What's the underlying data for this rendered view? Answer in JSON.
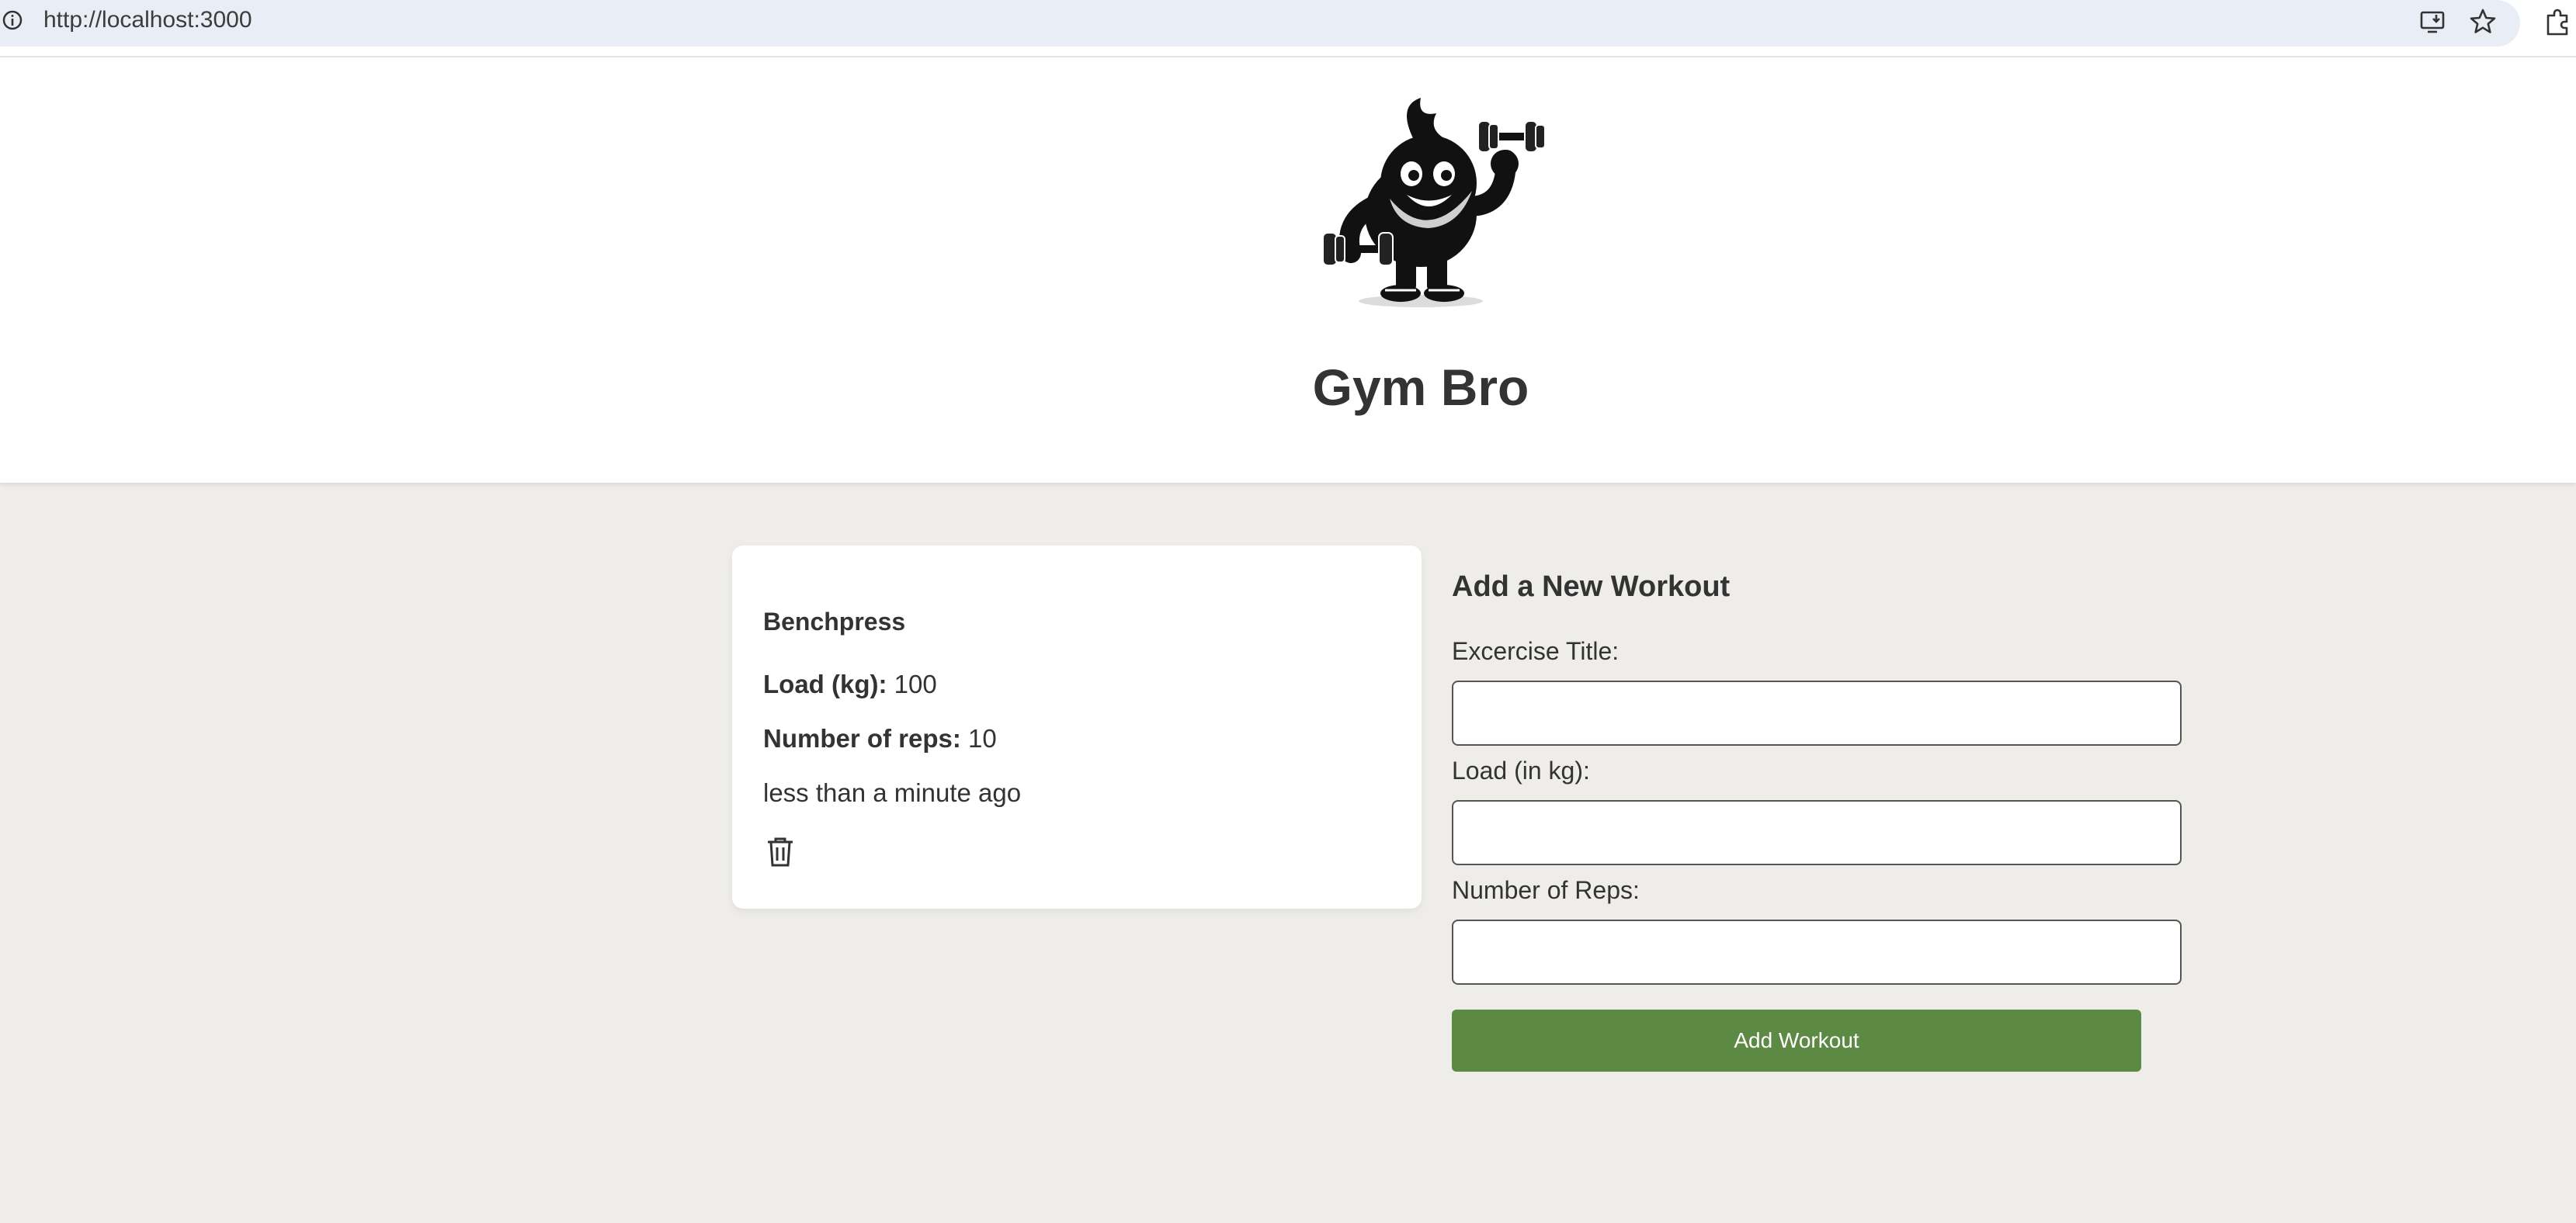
{
  "browser": {
    "url": "http://localhost:3000",
    "icons": [
      "info-icon",
      "install-app-icon",
      "bookmark-star-icon",
      "extensions-icon"
    ]
  },
  "header": {
    "logo": "gym-mascot-logo",
    "title": "Gym Bro"
  },
  "workouts": [
    {
      "title": "Benchpress",
      "load_label": "Load (kg):",
      "load_value": "100",
      "reps_label": "Number of reps:",
      "reps_value": "10",
      "time": "less than a minute ago",
      "delete_icon": "trash-icon"
    }
  ],
  "form": {
    "heading": "Add a New Workout",
    "title_label": "Excercise Title:",
    "title_value": "",
    "load_label": "Load (in kg):",
    "load_value": "",
    "reps_label": "Number of Reps:",
    "reps_value": "",
    "submit_label": "Add Workout"
  },
  "colors": {
    "page_background": "#eeedea",
    "header_background": "#ffffff",
    "button_background": "#5c8a44",
    "text": "#333333"
  }
}
